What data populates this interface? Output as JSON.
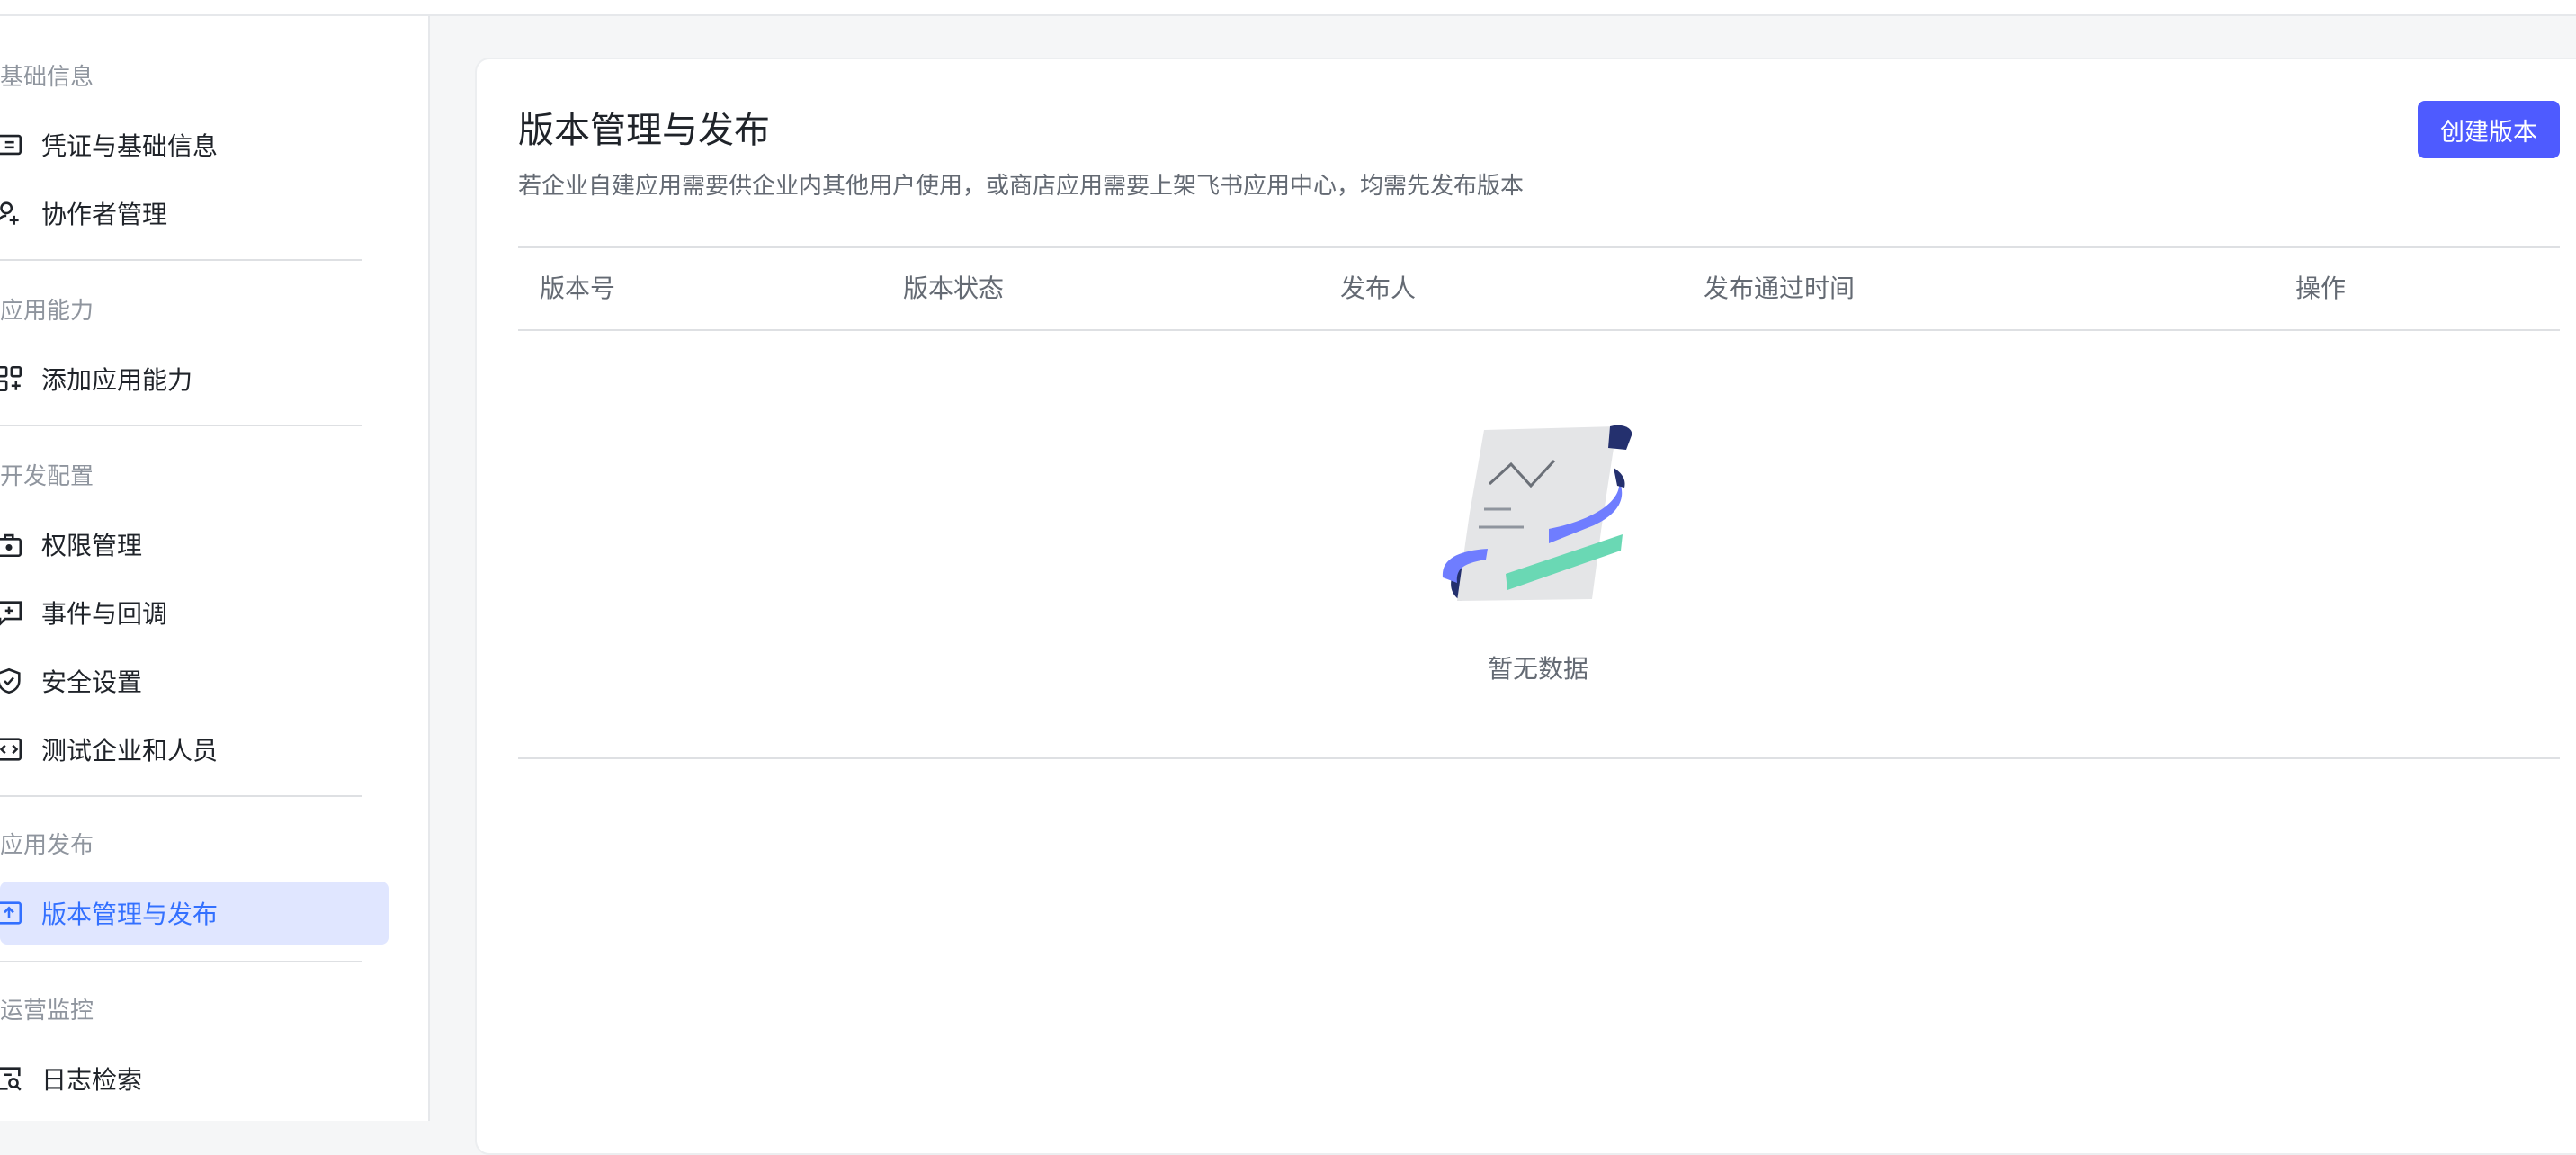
{
  "sidebar": {
    "groups": [
      {
        "title": "基础信息",
        "items": [
          {
            "label": "凭证与基础信息",
            "icon": "id-card-icon"
          },
          {
            "label": "协作者管理",
            "icon": "user-add-icon"
          }
        ]
      },
      {
        "title": "应用能力",
        "items": [
          {
            "label": "添加应用能力",
            "icon": "apps-add-icon"
          }
        ]
      },
      {
        "title": "开发配置",
        "items": [
          {
            "label": "权限管理",
            "icon": "lock-box-icon"
          },
          {
            "label": "事件与回调",
            "icon": "message-plus-icon"
          },
          {
            "label": "安全设置",
            "icon": "shield-check-icon"
          },
          {
            "label": "测试企业和人员",
            "icon": "code-box-icon"
          }
        ]
      },
      {
        "title": "应用发布",
        "items": [
          {
            "label": "版本管理与发布",
            "icon": "upload-box-icon",
            "active": true
          }
        ]
      },
      {
        "title": "运营监控",
        "items": [
          {
            "label": "日志检索",
            "icon": "log-search-icon"
          }
        ]
      }
    ]
  },
  "main": {
    "title": "版本管理与发布",
    "description": "若企业自建应用需要供企业内其他用户使用，或商店应用需要上架飞书应用中心，均需先发布版本",
    "create_button": "创建版本",
    "table": {
      "columns": [
        "版本号",
        "版本状态",
        "发布人",
        "发布通过时间",
        "操作"
      ],
      "rows": []
    },
    "empty_text": "暂无数据"
  },
  "colors": {
    "accent": "#4e5bff",
    "active_bg": "#e0e6ff",
    "active_text": "#3370ff"
  }
}
